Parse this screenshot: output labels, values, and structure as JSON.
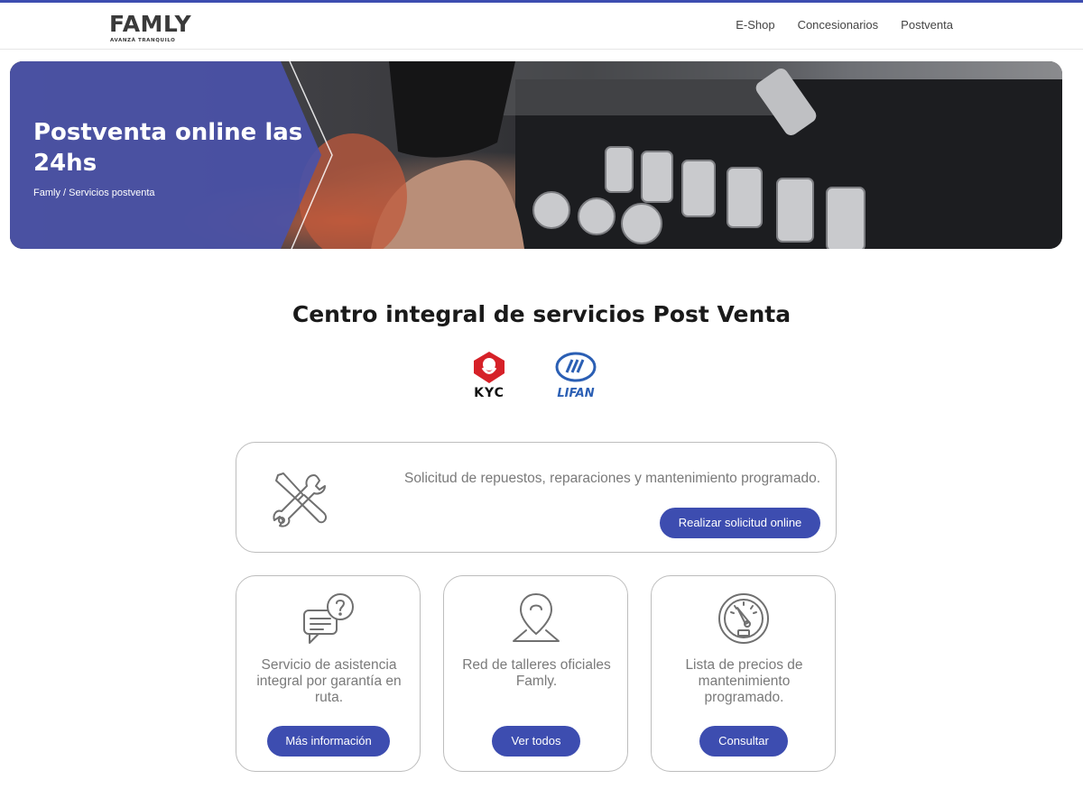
{
  "header": {
    "logo_text": "FAMLY",
    "logo_tagline": "AVANZÁ TRANQUILO",
    "nav": [
      {
        "label": "E-Shop"
      },
      {
        "label": "Concesionarios"
      },
      {
        "label": "Postventa"
      }
    ],
    "accent_color": "#3d4db0"
  },
  "hero": {
    "title": "Postventa online las 24hs",
    "breadcrumb": "Famly / Servicios postventa",
    "panel_color": "#4a52a8"
  },
  "main": {
    "title": "Centro integral de servicios Post Venta",
    "brands": [
      {
        "name": "KYC",
        "icon": "kyc-logo"
      },
      {
        "name": "LIFAN",
        "icon": "lifan-logo"
      }
    ],
    "wide_card": {
      "icon": "tools-icon",
      "text": "Solicitud de repuestos, reparaciones y mantenimiento programado.",
      "button": "Realizar solicitud online"
    },
    "cards": [
      {
        "icon": "chat-question-icon",
        "text": "Servicio de asistencia integral por garantía en ruta.",
        "button": "Más información"
      },
      {
        "icon": "map-pin-icon",
        "text": "Red de talleres oficiales Famly.",
        "button": "Ver todos"
      },
      {
        "icon": "gauge-icon",
        "text": "Lista de precios de mantenimiento programado.",
        "button": "Consultar"
      }
    ]
  }
}
